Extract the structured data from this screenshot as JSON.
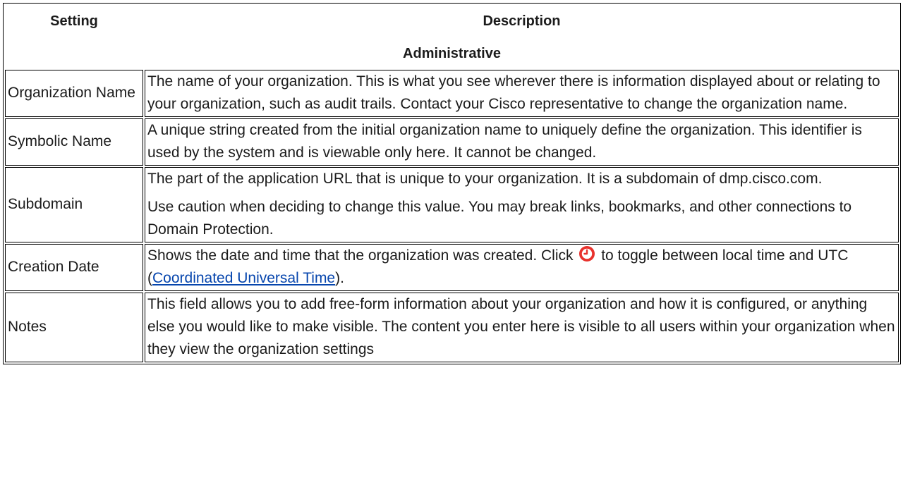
{
  "table": {
    "headers": {
      "setting": "Setting",
      "description": "Description"
    },
    "section": "Administrative",
    "rows": [
      {
        "setting": "Organization Name",
        "description": "The name of your organization. This is what you see wherever there is information dis­played about or relating to your organization, such as audit trails. Contact your Cisco representative to change the organization name."
      },
      {
        "setting": "Symbolic Name",
        "description": "A unique string created from the initial organization name to uniquely define the organ­ization. This identifier is used by the system and is viewable only here. It cannot be changed."
      },
      {
        "setting": "Subdomain",
        "paragraphs": [
          "The part of the application URL that is unique to your organization. It is a subdomain of dmp.cisco.com.",
          "Use caution when deciding to change this value. You may break links, bookmarks, and other connections to Domain Protection."
        ]
      },
      {
        "setting": "Creation Date",
        "description_before_icon": "Shows the date and time that the organization was created. Click",
        "icon": "clock-icon",
        "description_after_icon": "to toggle between local time and UTC (",
        "link_text": "Coordinated Universal Time",
        "description_end": ")."
      },
      {
        "setting": "Notes",
        "description": "This field allows you to add free-form information about your organization and how it is configured, or anything else you would like to make visible. The content you enter here is visible to all users within your organization when they view the organization settings"
      }
    ]
  },
  "colors": {
    "link": "#0645ad",
    "icon_fill": "#e8322d",
    "border": "#000000"
  }
}
